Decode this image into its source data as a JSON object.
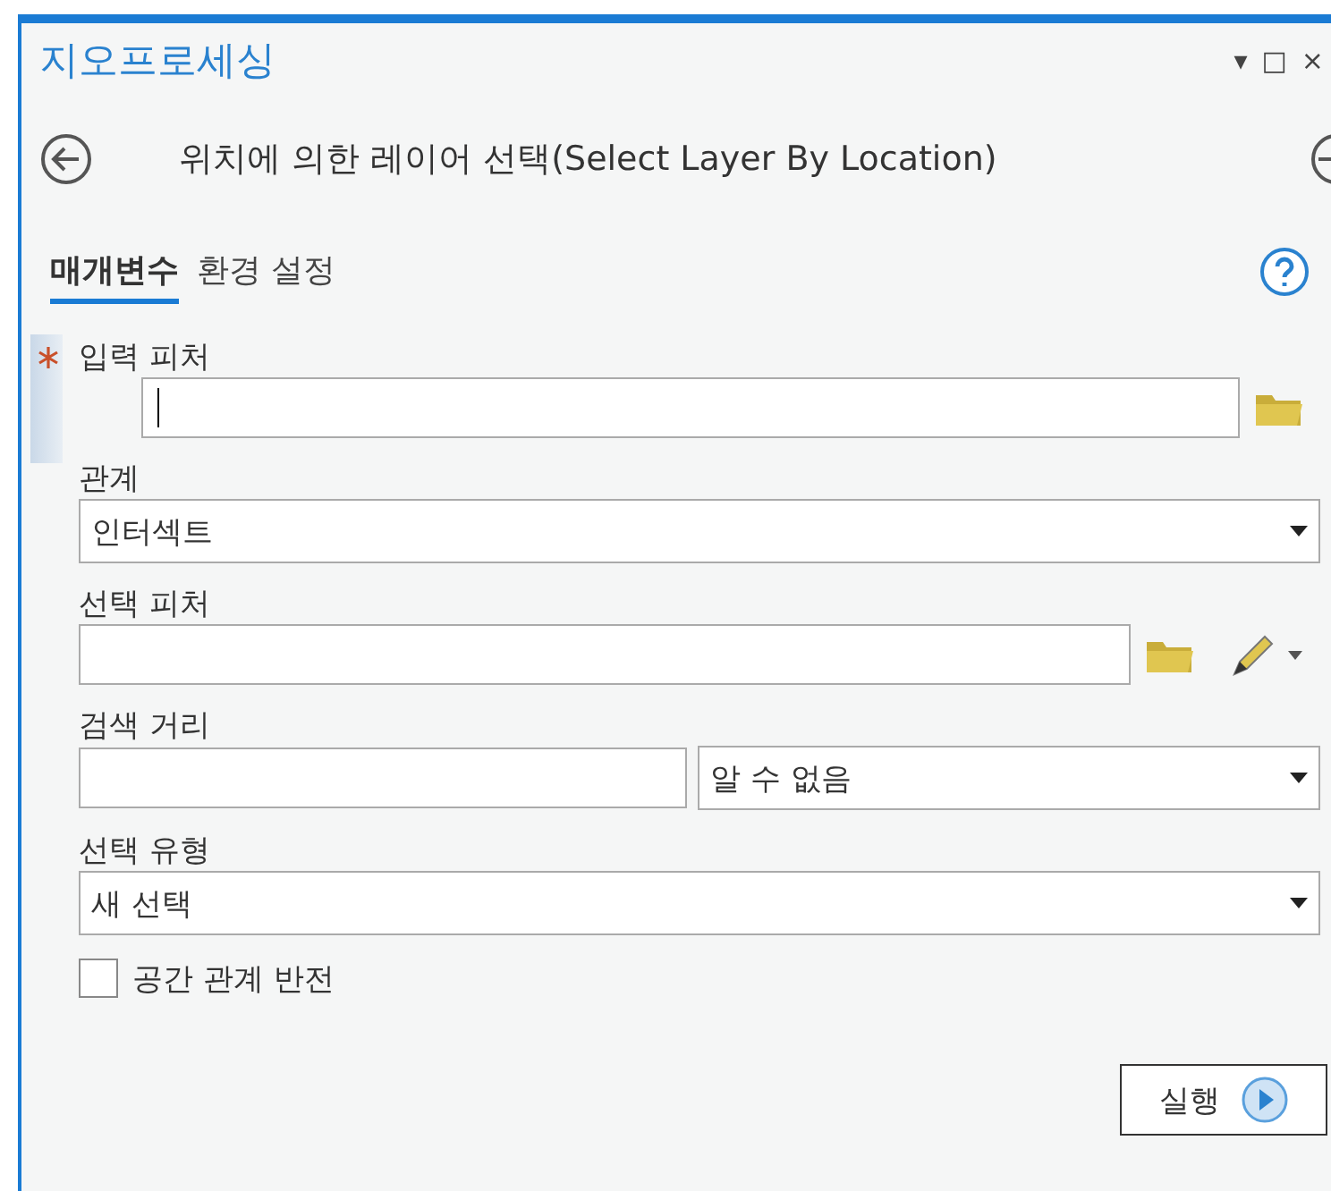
{
  "panel": {
    "title": "지오프로세싱",
    "controls": [
      "▾",
      "□",
      "×"
    ]
  },
  "tool": {
    "title": "위치에 의한 레이어 선택(Select Layer By Location)"
  },
  "tabs": [
    {
      "label": "매개변수",
      "selected": true
    },
    {
      "label": "환경 설정",
      "selected": false
    }
  ],
  "parameters": [
    {
      "kind": "feature",
      "label": "입력 피처",
      "required": true,
      "focused": true,
      "editable": false
    },
    {
      "kind": "dropdown",
      "label": "관계",
      "value": "인터섹트"
    },
    {
      "kind": "feature",
      "label": "선택 피처",
      "required": false,
      "focused": false,
      "editable": true
    },
    {
      "kind": "distance",
      "label": "검색 거리",
      "unit": "알 수 없음"
    },
    {
      "kind": "dropdown",
      "label": "선택 유형",
      "value": "새 선택"
    },
    {
      "kind": "checkbox",
      "label": "공간 관계 반전",
      "checked": false
    }
  ],
  "run_button": {
    "label": "실행"
  }
}
